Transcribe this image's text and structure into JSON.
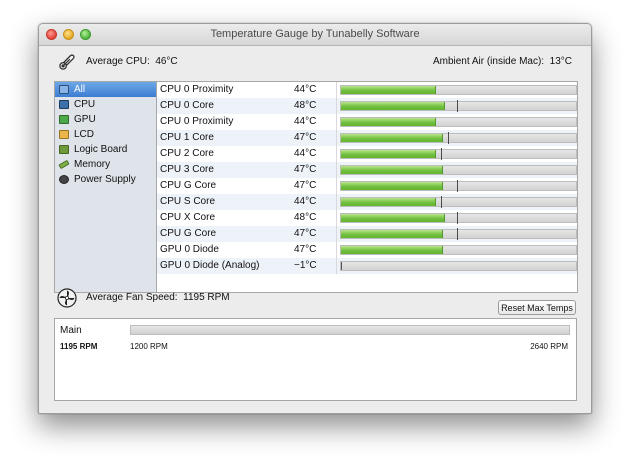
{
  "window": {
    "title": "Temperature Gauge by Tunabelly Software"
  },
  "header": {
    "avg_cpu_label": "Average CPU:",
    "avg_cpu_value": "46°C",
    "ambient_label": "Ambient Air (inside Mac):",
    "ambient_value": "13°C"
  },
  "sidebar": {
    "items": [
      {
        "label": "All",
        "icon": "monitor-icon",
        "selected": true
      },
      {
        "label": "CPU",
        "icon": "chip-icon",
        "selected": false
      },
      {
        "label": "GPU",
        "icon": "gpu-icon",
        "selected": false
      },
      {
        "label": "LCD",
        "icon": "lcd-icon",
        "selected": false
      },
      {
        "label": "Logic Board",
        "icon": "board-icon",
        "selected": false
      },
      {
        "label": "Memory",
        "icon": "memory-icon",
        "selected": false
      },
      {
        "label": "Power Supply",
        "icon": "power-icon",
        "selected": false
      }
    ]
  },
  "sensors": [
    {
      "name": "CPU 0 Proximity",
      "temp": "44°C",
      "fill": 0.4,
      "max": null
    },
    {
      "name": "CPU 0 Core",
      "temp": "48°C",
      "fill": 0.44,
      "max": 0.49
    },
    {
      "name": "CPU 0 Proximity",
      "temp": "44°C",
      "fill": 0.4,
      "max": null
    },
    {
      "name": "CPU 1 Core",
      "temp": "47°C",
      "fill": 0.43,
      "max": 0.45
    },
    {
      "name": "CPU 2 Core",
      "temp": "44°C",
      "fill": 0.4,
      "max": 0.42
    },
    {
      "name": "CPU 3 Core",
      "temp": "47°C",
      "fill": 0.43,
      "max": null
    },
    {
      "name": "CPU G Core",
      "temp": "47°C",
      "fill": 0.43,
      "max": 0.49
    },
    {
      "name": "CPU S Core",
      "temp": "44°C",
      "fill": 0.4,
      "max": 0.42
    },
    {
      "name": "CPU X Core",
      "temp": "48°C",
      "fill": 0.44,
      "max": 0.49
    },
    {
      "name": "CPU G Core",
      "temp": "47°C",
      "fill": 0.43,
      "max": 0.49
    },
    {
      "name": "GPU 0 Diode",
      "temp": "47°C",
      "fill": 0.43,
      "max": null
    },
    {
      "name": "GPU 0 Diode (Analog)",
      "temp": "−1°C",
      "fill": 0.0,
      "max": null
    }
  ],
  "controls": {
    "reset_label": "Reset Max Temps"
  },
  "fan": {
    "avg_label": "Average Fan Speed:",
    "avg_value": "1195 RPM",
    "items": [
      {
        "name": "Main",
        "current": "1195 RPM",
        "min": "1200 RPM",
        "max": "2640 RPM"
      }
    ]
  },
  "colors": {
    "bar_fill": "#72c040",
    "selection": "#3d7bd2",
    "row_alt": "#eef3fa"
  }
}
